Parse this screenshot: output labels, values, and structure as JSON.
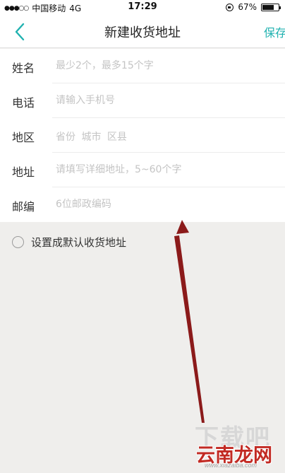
{
  "status_bar": {
    "signal": "●●●○○",
    "carrier": "中国移动",
    "network": "4G",
    "time": "17:29",
    "battery": "67%"
  },
  "nav": {
    "title": "新建收货地址",
    "save_label": "保存",
    "accent_color": "#20b2b0"
  },
  "form": {
    "name": {
      "label": "姓名",
      "placeholder": "最少2个，最多15个字",
      "value": ""
    },
    "phone": {
      "label": "电话",
      "placeholder": "请输入手机号",
      "value": ""
    },
    "region": {
      "label": "地区",
      "placeholder": "省份 城市 区县"
    },
    "address": {
      "label": "地址",
      "placeholder": "请填写详细地址，5~60个字",
      "value": ""
    },
    "postcode": {
      "label": "邮编",
      "placeholder": "6位邮政编码",
      "value": ""
    }
  },
  "default_option": {
    "label": "设置成默认收货地址",
    "checked": false
  },
  "annotation": {
    "color": "#8b1a1a",
    "icon": "red-arrow"
  },
  "watermark": {
    "big": "下载吧",
    "main": "云南龙网",
    "url": "www.xiazaiba.com",
    "brand_color": "#c22a23"
  }
}
